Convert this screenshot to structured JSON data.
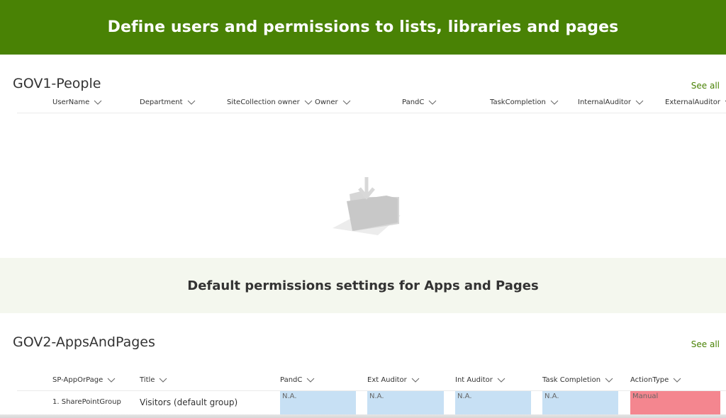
{
  "banner": {
    "title": "Define users and permissions to lists, libraries and pages",
    "color": "#498205"
  },
  "people": {
    "title": "GOV1-People",
    "see_all": "See all",
    "columns": [
      "UserName",
      "Department",
      "SiteCollection owner",
      "Owner",
      "PandC",
      "TaskCompletion",
      "InternalAuditor",
      "ExternalAuditor"
    ],
    "empty_icon": "empty-folder-icon"
  },
  "band": {
    "title": "Default permissions settings for Apps and Pages"
  },
  "apps": {
    "title": "GOV2-AppsAndPages",
    "see_all": "See all",
    "columns": [
      "SP-AppOrPage",
      "Title",
      "PandC",
      "Ext Auditor",
      "Int Auditor",
      "Task Completion",
      "ActionType"
    ],
    "rows": [
      {
        "sp_app_or_page": "1. SharePointGroup",
        "title": "Visitors (default group)",
        "pandc": "N.A.",
        "ext_auditor": "N.A.",
        "int_auditor": "N.A.",
        "task_completion": "N.A.",
        "action_type": "Manual"
      }
    ]
  },
  "colors": {
    "na_cell": "#c7e0f4",
    "manual_cell": "#f4868f",
    "band": "#f4f7ee",
    "accent": "#498205"
  }
}
